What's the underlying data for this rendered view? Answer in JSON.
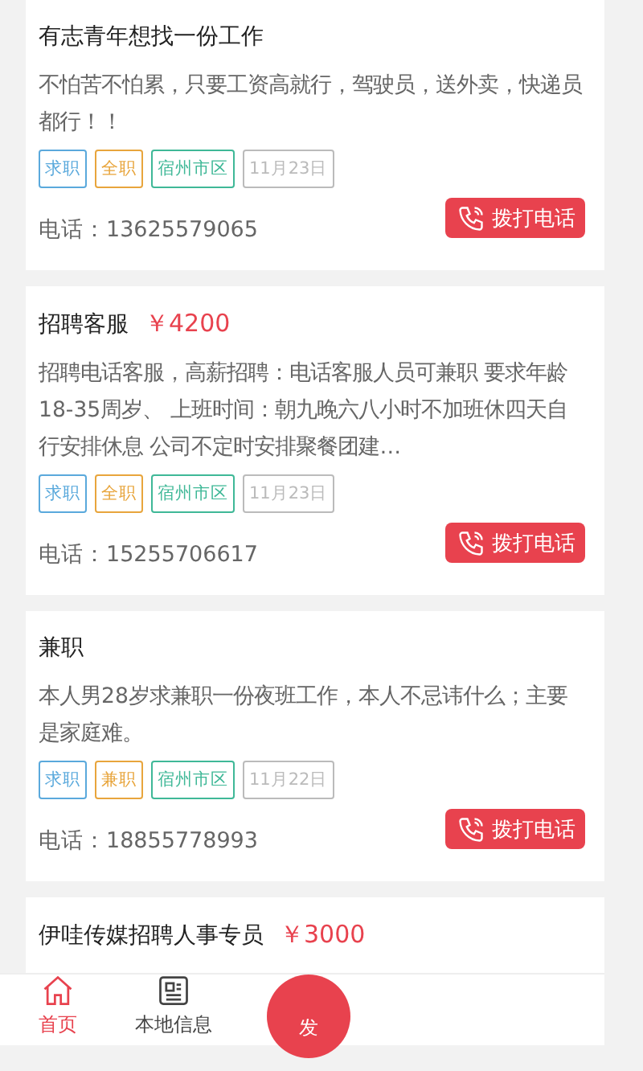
{
  "listings": [
    {
      "title": "有志青年想找一份工作",
      "description": "不怕苦不怕累，只要工资高就行，驾驶员，送外卖，快递员都行！！",
      "tags": [
        {
          "label": "求职",
          "color": "#5aa9dc"
        },
        {
          "label": "全职",
          "color": "#e8a53c"
        },
        {
          "label": "宿州市区",
          "color": "#3fb897"
        },
        {
          "label": "11月23日",
          "color": "#bbbbbb"
        }
      ],
      "phone": "电话：13625579065",
      "call_button": "拨打电话"
    },
    {
      "title": "招聘客服",
      "salary": "￥4200",
      "description": "招聘电话客服，高薪招聘：电话客服人员可兼职 要求年龄18-35周岁、 上班时间：朝九晚六八小时不加班休四天自行安排休息 公司不定时安排聚餐团建…",
      "tags": [
        {
          "label": "求职",
          "color": "#5aa9dc"
        },
        {
          "label": "全职",
          "color": "#e8a53c"
        },
        {
          "label": "宿州市区",
          "color": "#3fb897"
        },
        {
          "label": "11月23日",
          "color": "#bbbbbb"
        }
      ],
      "phone": "电话：15255706617",
      "call_button": "拨打电话"
    },
    {
      "title": "兼职",
      "description": "本人男28岁求兼职一份夜班工作，本人不忌讳什么；主要是家庭难。",
      "tags": [
        {
          "label": "求职",
          "color": "#5aa9dc"
        },
        {
          "label": "兼职",
          "color": "#e8a53c"
        },
        {
          "label": "宿州市区",
          "color": "#3fb897"
        },
        {
          "label": "11月22日",
          "color": "#bbbbbb"
        }
      ],
      "phone": "电话：18855778993",
      "call_button": "拨打电话"
    },
    {
      "title": "伊哇传媒招聘人事专员",
      "salary": "￥3000"
    }
  ],
  "bottom_nav": {
    "items": [
      {
        "label": "首页",
        "kind": "home",
        "selected": true
      },
      {
        "label": "本地信息",
        "kind": "news",
        "selected": false
      }
    ],
    "publish_button": "发"
  }
}
